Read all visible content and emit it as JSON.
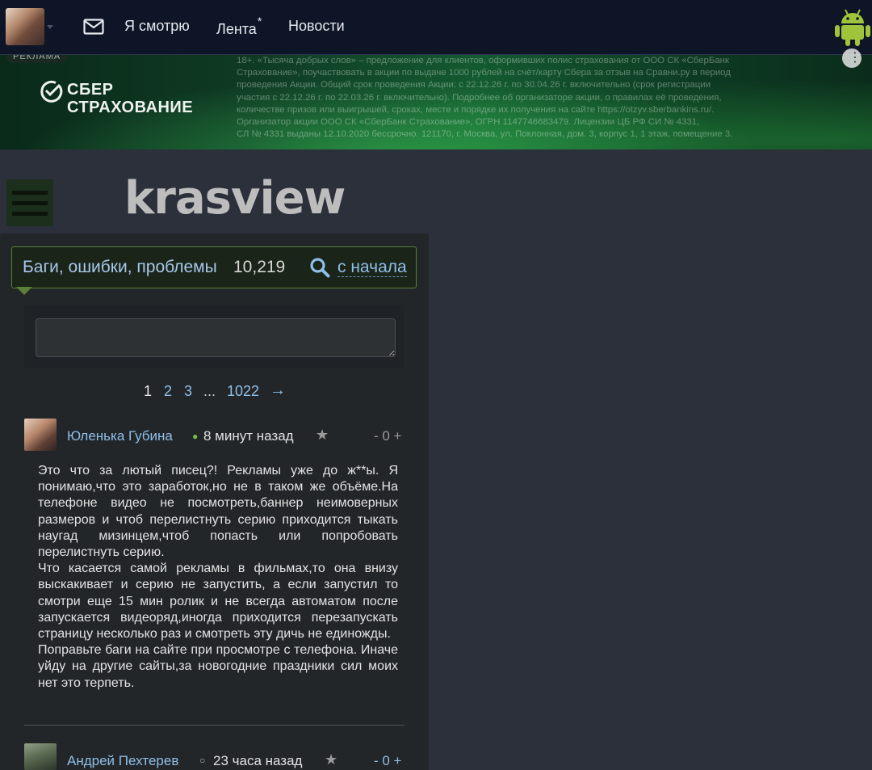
{
  "topbar": {
    "nav": {
      "watching": "Я смотрю",
      "feed": "Лента",
      "feed_marker": "*",
      "news": "Новости"
    },
    "icons": [
      "mail-icon",
      "android-icon"
    ]
  },
  "ad": {
    "tag": "РЕКЛАМА",
    "brand": "СБЕР СТРАХОВАНИЕ",
    "legal": "18+. «Тысяча добрых слов» – предложение для клиентов, оформивших полис страхования от ООО СК «СберБанк\nСтрахование», поучаствовать в акции по выдаче 1000 рублей на счёт/карту Сбера за отзыв на Сравни.ру в период\nпроведения Акции. Общий срок проведения Акции: с 22.12.26 г. по 30.04.26 г. включительно (срок регистрации\nучастия с 22.12.26 г. по 22.03.26 г. включительно). Подробнее об организаторе акции, о правилах её проведения,\nколичестве призов или выигрышей, сроках, месте и порядке их получения на сайте https://otzyv.sberbankins.ru/.\nОрганизатор акции ООО СК «СберБанк Страхование», ОГРН 1147746683479. Лицензии ЦБ РФ СИ № 4331,\nСЛ № 4331 выданы 12.10.2020 бессрочно. 121170, г. Москва, ул. Поклонная, дом. 3, корпус 1, 1 этаж, помещение 3."
  },
  "site": {
    "logo": "krasview"
  },
  "topic": {
    "title": "Баги, ошибки, проблемы",
    "count": "10,219",
    "from_start": "с начала"
  },
  "pagination": {
    "current": "1",
    "p2": "2",
    "p3": "3",
    "dots": "...",
    "last": "1022",
    "next": "→"
  },
  "comments": [
    {
      "author": "Юленька Губина",
      "time": "8 минут назад",
      "vote": "- 0 +",
      "text": "Это что за лютый писец?! Рекламы уже до ж**ы. Я понимаю,что это заработок,но не в таком же объёме.На телефоне видео не посмотреть,баннер неимоверных размеров и чтоб перелистнуть серию приходится тыкать наугад мизинцем,чтоб попасть или попробовать перелистнуть серию.\nЧто касается самой рекламы в фильмах,то она внизу выскакивает и серию не запустить, а если запустил то смотри еще 15 мин ролик и не всегда автоматом после запускается видеоряд,иногда приходится перезапускать страницу несколько раз и смотреть эту дичь не единожды.\nПоправьте баги на сайте при просмотре с телефона. Иначе уйду на другие сайты,за новогодние праздники сил моих нет это терпеть."
    },
    {
      "author": "Андрей Пехтерев",
      "time": "23 часа назад",
      "vote": "- 0 +"
    }
  ],
  "colors": {
    "topbar_bg": "#0e1526",
    "page_bg": "#2b303b",
    "panel_bg": "#232629",
    "link": "#8fbfe8",
    "accent_green": "#5a7f3a"
  }
}
